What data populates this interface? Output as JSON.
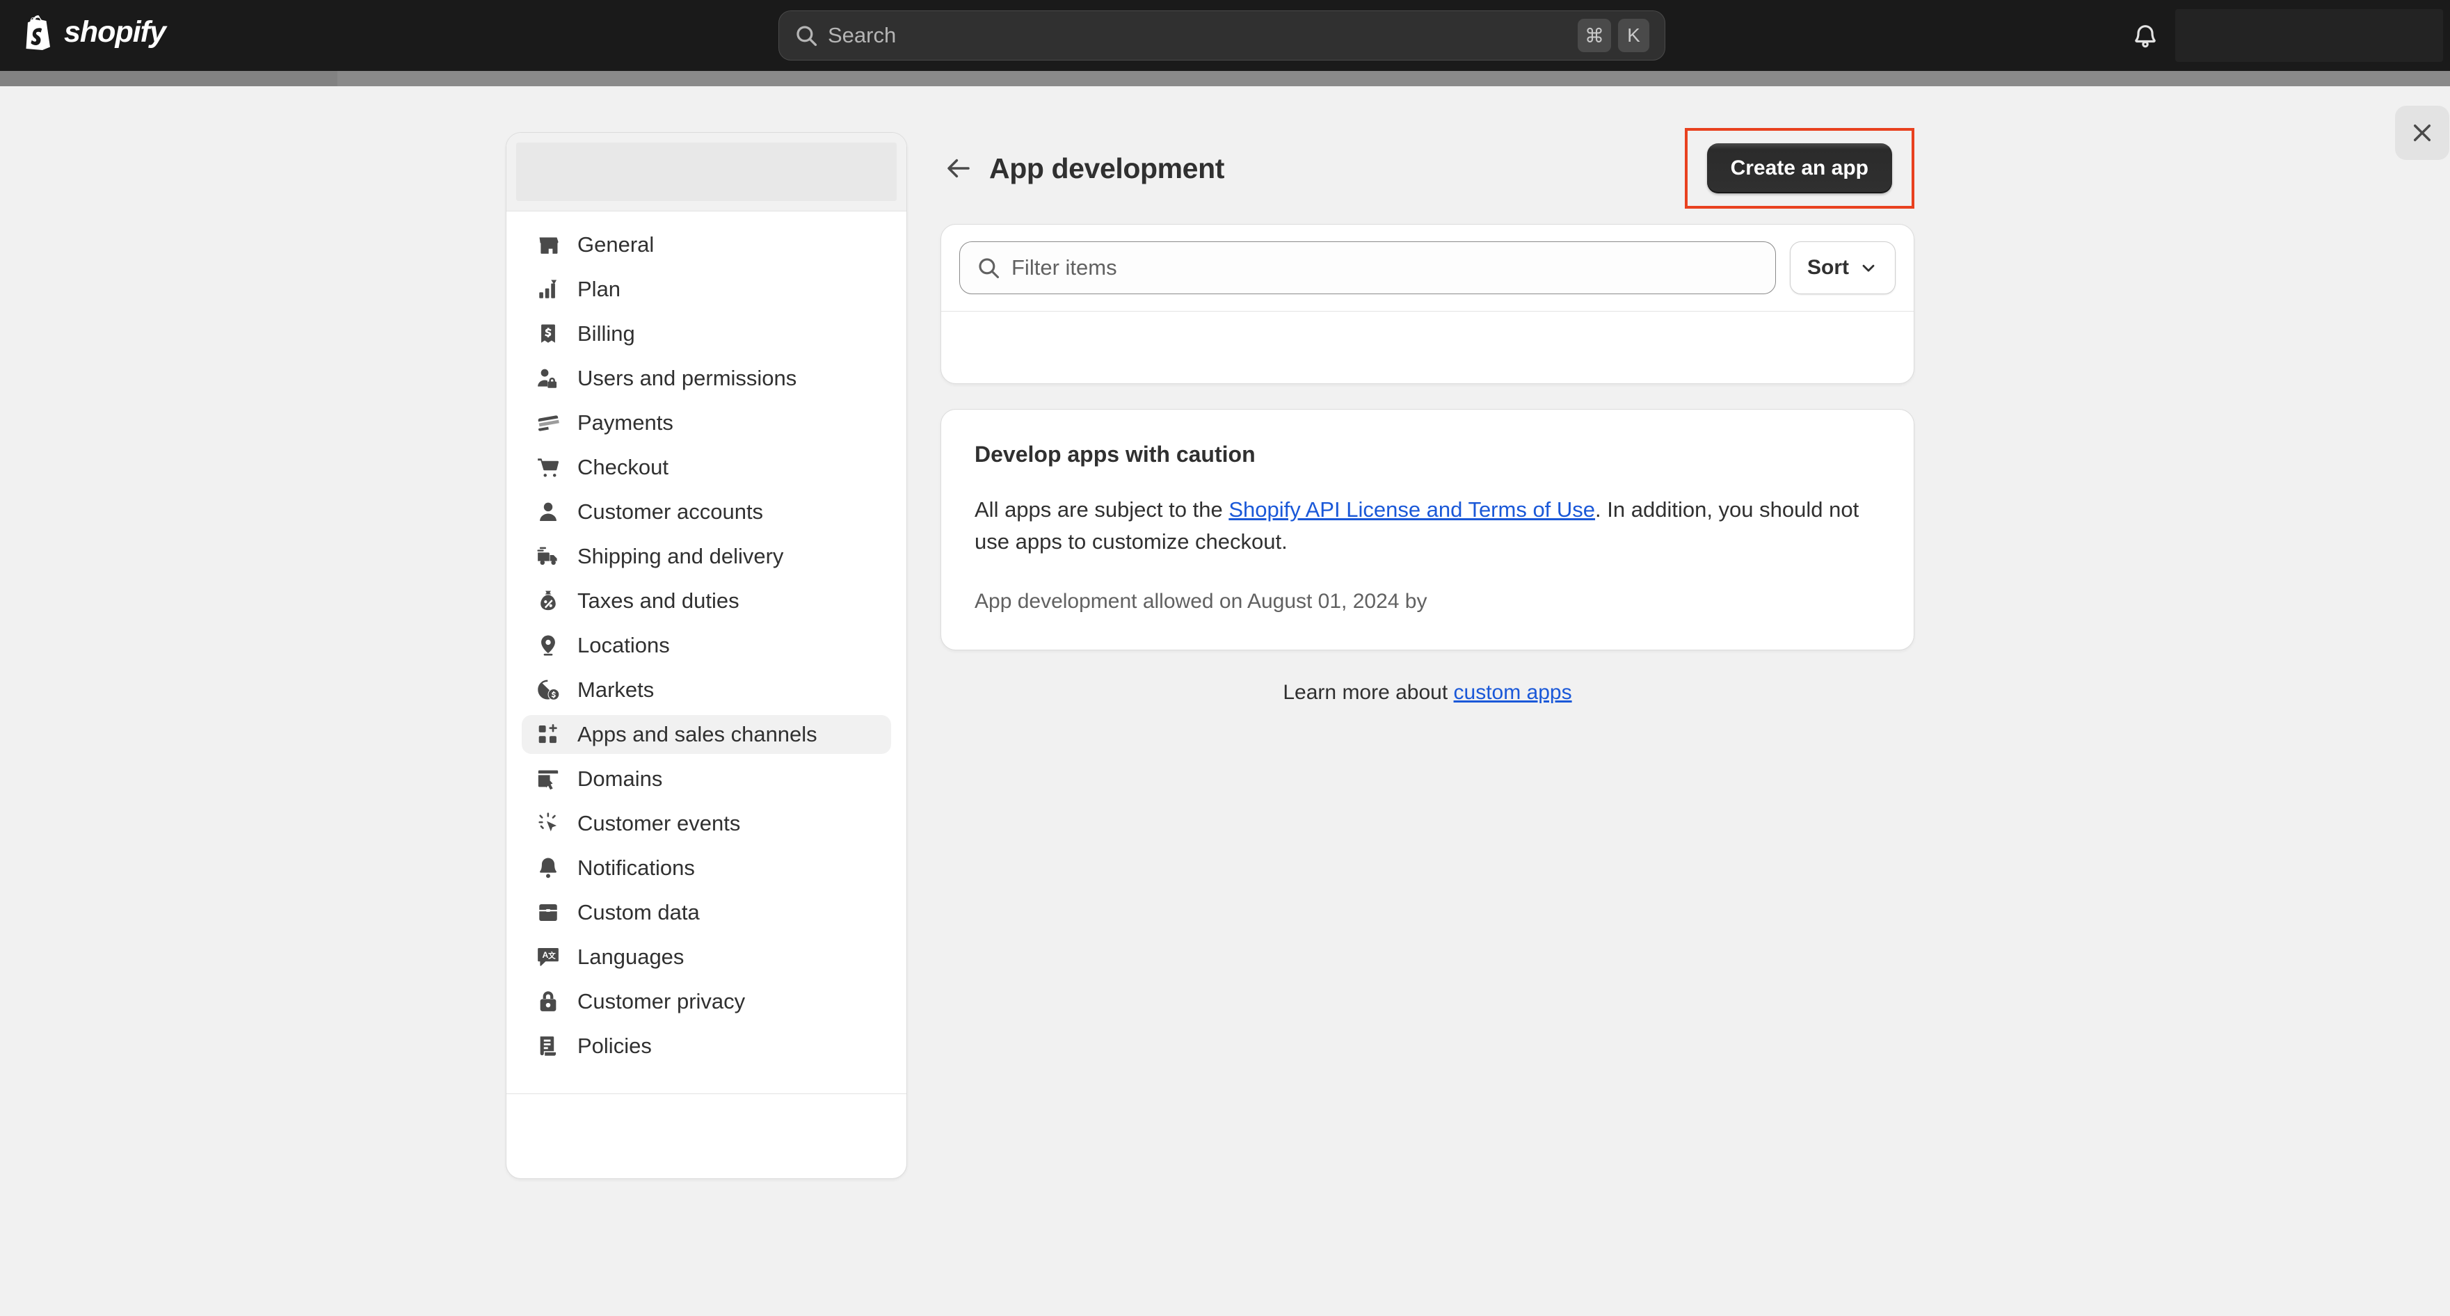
{
  "topbar": {
    "brand": "shopify",
    "brand_icon": "shopify-bag-logo",
    "search": {
      "icon": "search-icon",
      "placeholder": "Search",
      "shortcut_modifier": "⌘",
      "shortcut_key": "K"
    },
    "notifications_icon": "bell-icon",
    "store_chip_label": ""
  },
  "close_button": {
    "icon": "close-icon",
    "label": ""
  },
  "sidebar": {
    "skeleton_placeholder": "",
    "items": [
      {
        "label": "General",
        "icon": "storefront-icon",
        "active": false
      },
      {
        "label": "Plan",
        "icon": "chart-bars-icon",
        "active": false
      },
      {
        "label": "Billing",
        "icon": "bill-dollar-icon",
        "active": false
      },
      {
        "label": "Users and permissions",
        "icon": "person-lock-icon",
        "active": false
      },
      {
        "label": "Payments",
        "icon": "credit-card-swipe-icon",
        "active": false
      },
      {
        "label": "Checkout",
        "icon": "shopping-cart-icon",
        "active": false
      },
      {
        "label": "Customer accounts",
        "icon": "person-icon",
        "active": false
      },
      {
        "label": "Shipping and delivery",
        "icon": "delivery-truck-icon",
        "active": false
      },
      {
        "label": "Taxes and duties",
        "icon": "money-bag-percent-icon",
        "active": false
      },
      {
        "label": "Locations",
        "icon": "location-pin-icon",
        "active": false
      },
      {
        "label": "Markets",
        "icon": "globe-dollar-icon",
        "active": false
      },
      {
        "label": "Apps and sales channels",
        "icon": "apps-grid-plus-icon",
        "active": true
      },
      {
        "label": "Domains",
        "icon": "domain-cursor-icon",
        "active": false
      },
      {
        "label": "Customer events",
        "icon": "cursor-sparkle-icon",
        "active": false
      },
      {
        "label": "Notifications",
        "icon": "bell-icon",
        "active": false
      },
      {
        "label": "Custom data",
        "icon": "database-icon",
        "active": false
      },
      {
        "label": "Languages",
        "icon": "translate-icon",
        "active": false
      },
      {
        "label": "Customer privacy",
        "icon": "lock-icon",
        "active": false
      },
      {
        "label": "Policies",
        "icon": "scroll-document-icon",
        "active": false
      }
    ]
  },
  "main": {
    "back_icon": "arrow-left-icon",
    "title": "App development",
    "create_app_label": "Create an app",
    "highlight_color": "#e8411f",
    "filter": {
      "icon": "search-icon",
      "placeholder": "Filter items",
      "sort_label": "Sort",
      "sort_icon": "chevron-down-icon"
    },
    "caution": {
      "title": "Develop apps with caution",
      "body_before_link": "All apps are subject to the ",
      "link_text": "Shopify API License and Terms of Use",
      "body_after_link": ". In addition, you should not use apps to customize checkout.",
      "meta": "App development allowed on August 01, 2024 by"
    },
    "footer": {
      "learn_more_prefix": "Learn more about ",
      "learn_more_link": "custom apps"
    }
  }
}
